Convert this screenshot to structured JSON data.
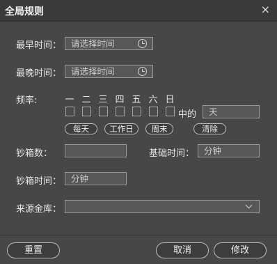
{
  "dialog": {
    "title": "全局规则",
    "close_icon": "×"
  },
  "earliest": {
    "label": "最早时间：",
    "placeholder": "请选择时间",
    "icon": "clock-icon"
  },
  "latest": {
    "label": "最晚时间：",
    "placeholder": "请选择时间",
    "icon": "clock-icon"
  },
  "frequency": {
    "label": "频率:",
    "days": [
      "一",
      "二",
      "三",
      "四",
      "五",
      "六",
      "日"
    ],
    "middle_label": "中的",
    "unit_value": "天",
    "presets": [
      "每天",
      "工作日",
      "周末",
      "清除"
    ]
  },
  "box_count": {
    "label": "钞箱数：",
    "value": ""
  },
  "base_time": {
    "label": "基础时间：",
    "value": "分钟"
  },
  "box_time": {
    "label": "钞箱时间：",
    "value": "分钟"
  },
  "source_vault": {
    "label": "来源金库：",
    "value": "",
    "icon": "chevron-down-icon"
  },
  "footer": {
    "reset": "重置",
    "cancel": "取消",
    "modify": "修改"
  }
}
